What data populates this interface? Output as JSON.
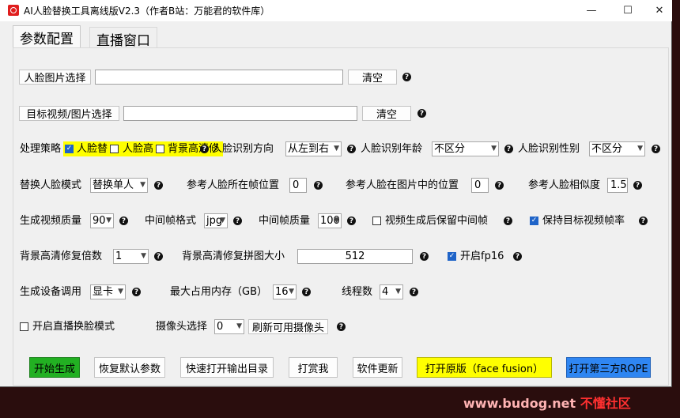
{
  "window": {
    "title": "AI人脸替换工具离线版V2.3（作者B站：万能君的软件库）",
    "minimize_glyph": "—",
    "maximize_glyph": "☐",
    "close_glyph": "✕"
  },
  "tabs": [
    {
      "label": "参数配置",
      "active": true
    },
    {
      "label": "直播窗口",
      "active": false
    }
  ],
  "face_image": {
    "button": "人脸图片选择",
    "value": "",
    "clear": "清空",
    "help": "?"
  },
  "target_video": {
    "button": "目标视频/图片选择",
    "value": "",
    "clear": "清空",
    "help": "?"
  },
  "processing": {
    "label": "处理策略",
    "options": [
      {
        "label": "人脸替",
        "checked": true
      },
      {
        "label": "人脸高",
        "checked": false
      },
      {
        "label": "背景高清修",
        "checked": false
      }
    ],
    "direction_label": "人脸识别方向",
    "direction_value": "从左到右",
    "age_label": "人脸识别年龄",
    "age_value": "不区分",
    "gender_label": "人脸识别性别",
    "gender_value": "不区分"
  },
  "replace": {
    "mode_label": "替换人脸模式",
    "mode_value": "替换单人",
    "frame_pos_label": "参考人脸所在帧位置",
    "frame_pos_value": "0",
    "image_pos_label": "参考人脸在图片中的位置",
    "image_pos_value": "0",
    "similarity_label": "参考人脸相似度",
    "similarity_value": "1.5"
  },
  "output": {
    "quality_label": "生成视频质量",
    "quality_value": "90",
    "frame_format_label": "中间帧格式",
    "frame_format_value": "jpg",
    "frame_quality_label": "中间帧质量",
    "frame_quality_value": "100",
    "keep_frames_label": "视频生成后保留中间帧",
    "keep_frames_checked": false,
    "keep_fps_label": "保持目标视频帧率",
    "keep_fps_checked": true
  },
  "enhance": {
    "scale_label": "背景高清修复倍数",
    "scale_value": "1",
    "tile_label": "背景高清修复拼图大小",
    "tile_value": "512",
    "fp16_label": "开启fp16",
    "fp16_checked": true
  },
  "device": {
    "device_label": "生成设备调用",
    "device_value": "显卡",
    "memory_label": "最大占用内存（GB）",
    "memory_value": "16",
    "threads_label": "线程数",
    "threads_value": "4"
  },
  "live": {
    "live_label": "开启直播换脸模式",
    "live_checked": false,
    "camera_label": "摄像头选择",
    "camera_value": "0",
    "refresh_label": "刷新可用摄像头"
  },
  "actions": {
    "start": "开始生成",
    "reset": "恢复默认参数",
    "open_output": "快速打开输出目录",
    "donate": "打赏我",
    "update": "软件更新",
    "open_original": "打开原版（face fusion）",
    "open_rope": "打开第三方ROPE"
  },
  "colors": {
    "start_bg": "#22b022",
    "original_bg": "#ffff00",
    "rope_bg": "#2f86f2",
    "checkbox_on": "#1f64c8"
  },
  "watermark": {
    "site": "www.budog.net",
    "name": "不懂社区"
  }
}
